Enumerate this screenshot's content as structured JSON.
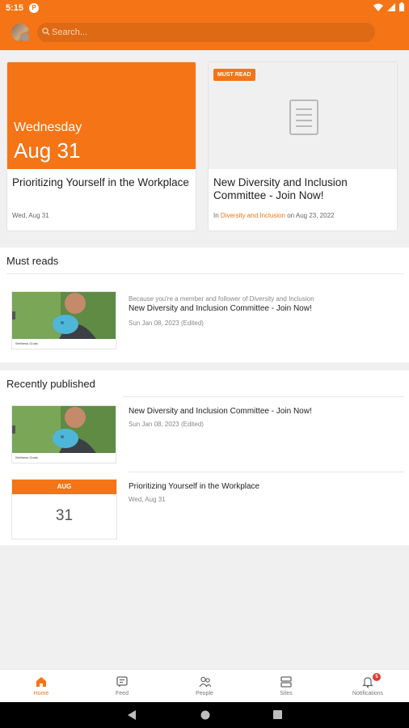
{
  "status_bar": {
    "time": "5:15",
    "app_badge": "P"
  },
  "top_bar": {
    "search_placeholder": "Search..."
  },
  "featured_cards": [
    {
      "weekday": "Wednesday",
      "date": "Aug 31",
      "title": "Prioritizing Yourself in the Workplace",
      "meta": "Wed, Aug 31"
    },
    {
      "badge": "MUST READ",
      "title": "New Diversity and Inclusion Committee - Join Now!",
      "meta_prefix": "In",
      "meta_link": "Diversity and Inclusion",
      "meta_suffix": "on Aug 23, 2022"
    }
  ],
  "must_reads": {
    "title": "Must reads",
    "items": [
      {
        "reason": "Because you're a member and follower of Diversity and Inclusion",
        "title": "New Diversity and Inclusion Committee - Join Now!",
        "date": "Sun Jan 08, 2023 (Edited)",
        "thumb_caption": "Wellness Goals"
      }
    ]
  },
  "recently_published": {
    "title": "Recently published",
    "items": [
      {
        "title": "New Diversity and Inclusion Committee - Join Now!",
        "date": "Sun Jan 08, 2023 (Edited)",
        "thumb_caption": "Wellness Goals"
      },
      {
        "title": "Prioritizing Yourself in the Workplace",
        "date": "Wed, Aug 31",
        "cal_month": "AUG",
        "cal_day": "31"
      }
    ]
  },
  "bottom_nav": [
    {
      "label": "Home",
      "icon": "home-icon",
      "active": true
    },
    {
      "label": "Feed",
      "icon": "feed-icon"
    },
    {
      "label": "People",
      "icon": "people-icon"
    },
    {
      "label": "Sites",
      "icon": "sites-icon"
    },
    {
      "label": "Notifications",
      "icon": "bell-icon",
      "count": "5"
    }
  ],
  "colors": {
    "accent": "#f57415",
    "badge_red": "#e53935"
  }
}
